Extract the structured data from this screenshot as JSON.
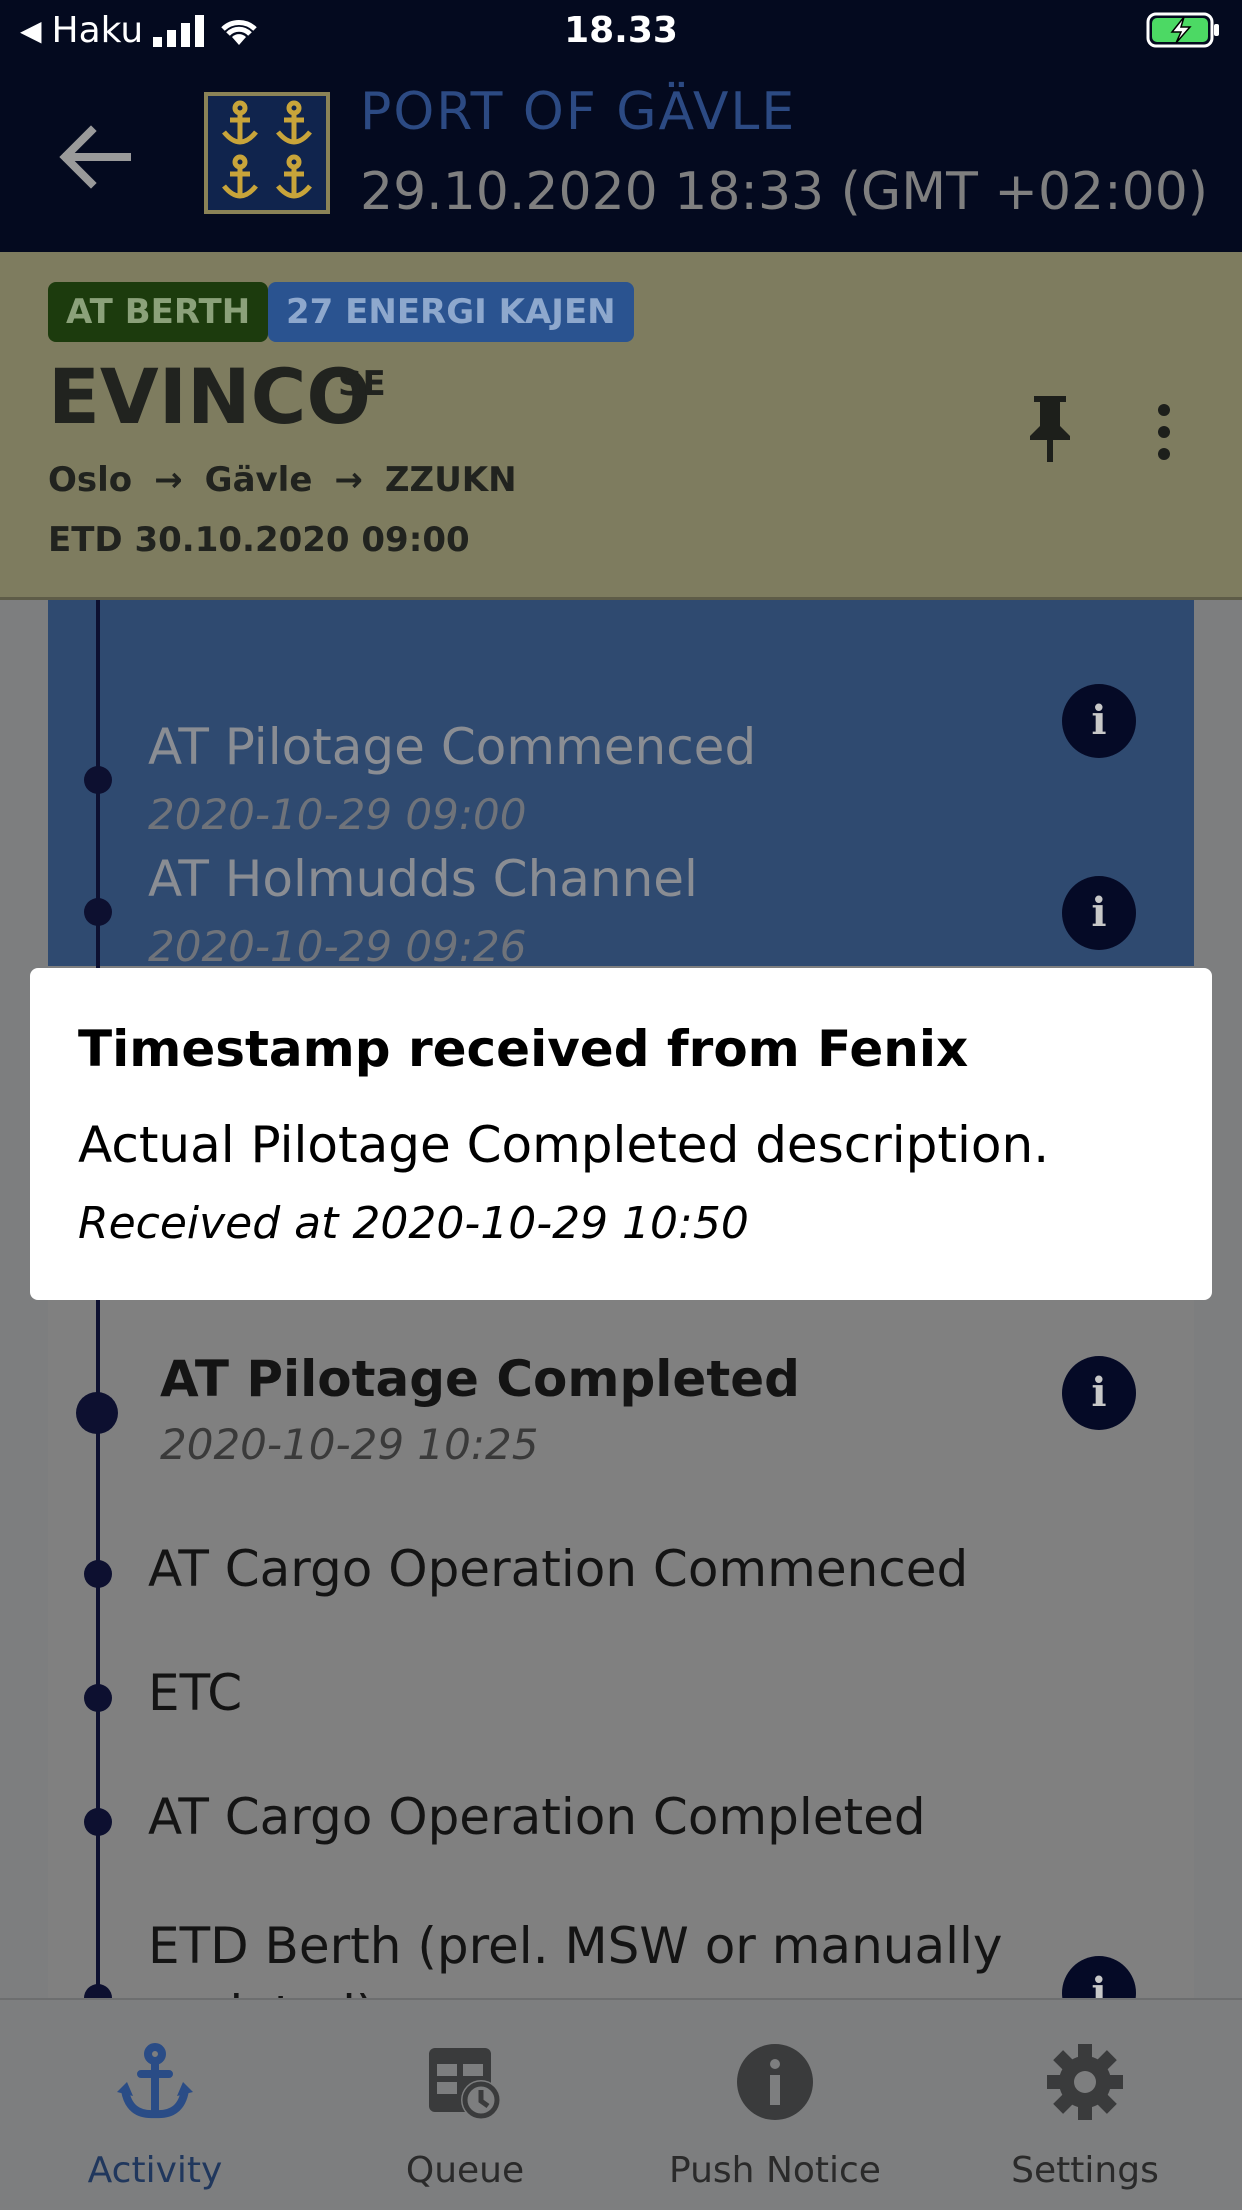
{
  "status_bar": {
    "carrier": "Haku",
    "time": "18.33"
  },
  "header": {
    "port_name": "PORT OF GÄVLE",
    "datetime": "29.10.2020 18:33 (GMT +02:00)"
  },
  "vessel": {
    "status_badge": "AT BERTH",
    "berth_badge": "27 ENERGI KAJEN",
    "name": "EVINCO",
    "flag": "SE",
    "route": [
      "Oslo",
      "Gävle",
      "ZZUKN"
    ],
    "etd": "ETD 30.10.2020 09:00"
  },
  "timeline": {
    "events": [
      {
        "title": "AT Pilotage Commenced",
        "date": "2020-10-29 09:00"
      },
      {
        "title": "AT Holmudds Channel",
        "date": "2020-10-29 09:26"
      },
      {
        "title": "AT Pilotage Completed",
        "date": "2020-10-29 10:25"
      },
      {
        "title": "AT Cargo Operation Commenced"
      },
      {
        "title": "ETC"
      },
      {
        "title": "AT Cargo Operation Completed"
      },
      {
        "title": "ETD Berth (prel. MSW or manually updated)"
      }
    ]
  },
  "modal": {
    "title": "Timestamp received from Fenix",
    "description": "Actual Pilotage Completed description.",
    "received": "Received at 2020-10-29 10:50"
  },
  "tabs": [
    {
      "label": "Activity",
      "icon": "anchor-icon",
      "active": true
    },
    {
      "label": "Queue",
      "icon": "calendar-clock-icon",
      "active": false
    },
    {
      "label": "Push Notice",
      "icon": "info-icon",
      "active": false
    },
    {
      "label": "Settings",
      "icon": "gear-icon",
      "active": false
    }
  ],
  "colors": {
    "header_bg": "#040a1f",
    "accent_blue": "#2a5390",
    "status_green": "#1c3b0d",
    "vessel_panel": "#7e7c5f"
  }
}
